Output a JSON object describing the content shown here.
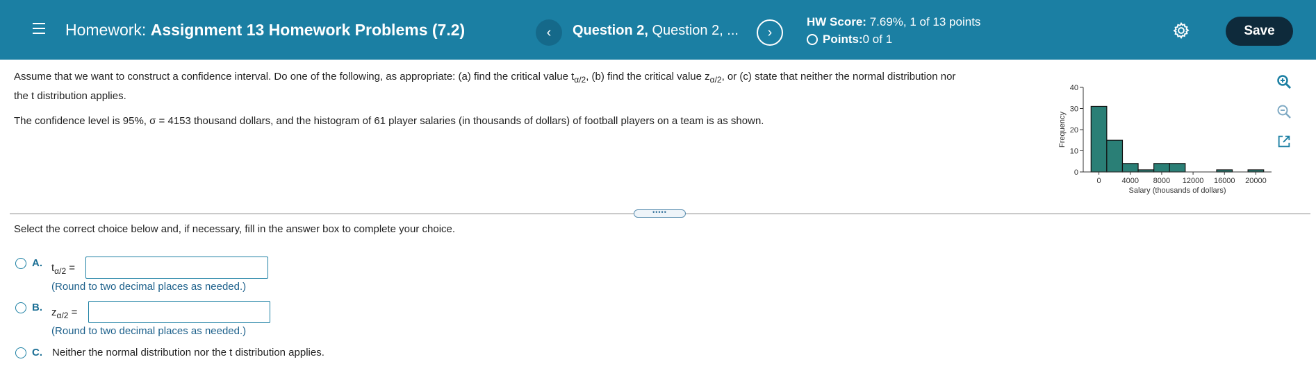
{
  "header": {
    "title_prefix": "Homework:",
    "title_main": "Assignment 13 Homework Problems (7.2)",
    "prev_symbol": "‹",
    "next_symbol": "›",
    "question_bold": "Question 2,",
    "question_rest": " Question 2, ...",
    "score_label": "HW Score:",
    "score_value": " 7.69%, 1 of 13 points",
    "points_label": "Points:",
    "points_value": " 0 of 1",
    "save_label": "Save"
  },
  "question": {
    "line1_a": "Assume that we want to construct a confidence interval. Do one of the following, as appropriate: (a) find the critical value t",
    "line1_sub1": "α/2",
    "line1_b": ", (b) find the critical value z",
    "line1_sub2": "α/2",
    "line1_c": ", or (c) state that neither the normal distribution nor",
    "line2": "the t distribution applies.",
    "line3": "The confidence level is 95%, σ = 4153 thousand dollars, and the histogram of 61 player salaries (in thousands of dollars) of football players on a team is as shown."
  },
  "chart_data": {
    "type": "bar",
    "xlabel": "Salary (thousands of dollars)",
    "ylabel": "Frequency",
    "ylim": [
      0,
      40
    ],
    "yticks": [
      "0",
      "10",
      "20",
      "30",
      "40"
    ],
    "xticks": [
      "0",
      "4000",
      "8000",
      "12000",
      "16000",
      "20000"
    ],
    "xlim": [
      -2000,
      22000
    ],
    "bin_width": 2000,
    "bins": [
      {
        "start": -1000,
        "value": 31
      },
      {
        "start": 1000,
        "value": 15
      },
      {
        "start": 3000,
        "value": 4
      },
      {
        "start": 5000,
        "value": 1
      },
      {
        "start": 7000,
        "value": 4
      },
      {
        "start": 9000,
        "value": 4
      },
      {
        "start": 11000,
        "value": 0
      },
      {
        "start": 13000,
        "value": 0
      },
      {
        "start": 15000,
        "value": 1
      },
      {
        "start": 17000,
        "value": 0
      },
      {
        "start": 19000,
        "value": 1
      }
    ],
    "bar_color": "#2a7f76"
  },
  "side_icons": [
    "zoom-in-icon",
    "zoom-out-icon",
    "popout-icon"
  ],
  "divider_handle": "•••••",
  "instructions": "Select the correct choice below and, if necessary, fill in the answer box to complete your choice.",
  "choices": {
    "a": {
      "letter": "A.",
      "var": "t",
      "sub": "α/2",
      "eq": " =",
      "hint": "(Round to two decimal places as needed.)"
    },
    "b": {
      "letter": "B.",
      "var": "z",
      "sub": "α/2",
      "eq": " =",
      "hint": "(Round to two decimal places as needed.)"
    },
    "c": {
      "letter": "C.",
      "text": "Neither the normal distribution nor the t distribution applies."
    }
  }
}
